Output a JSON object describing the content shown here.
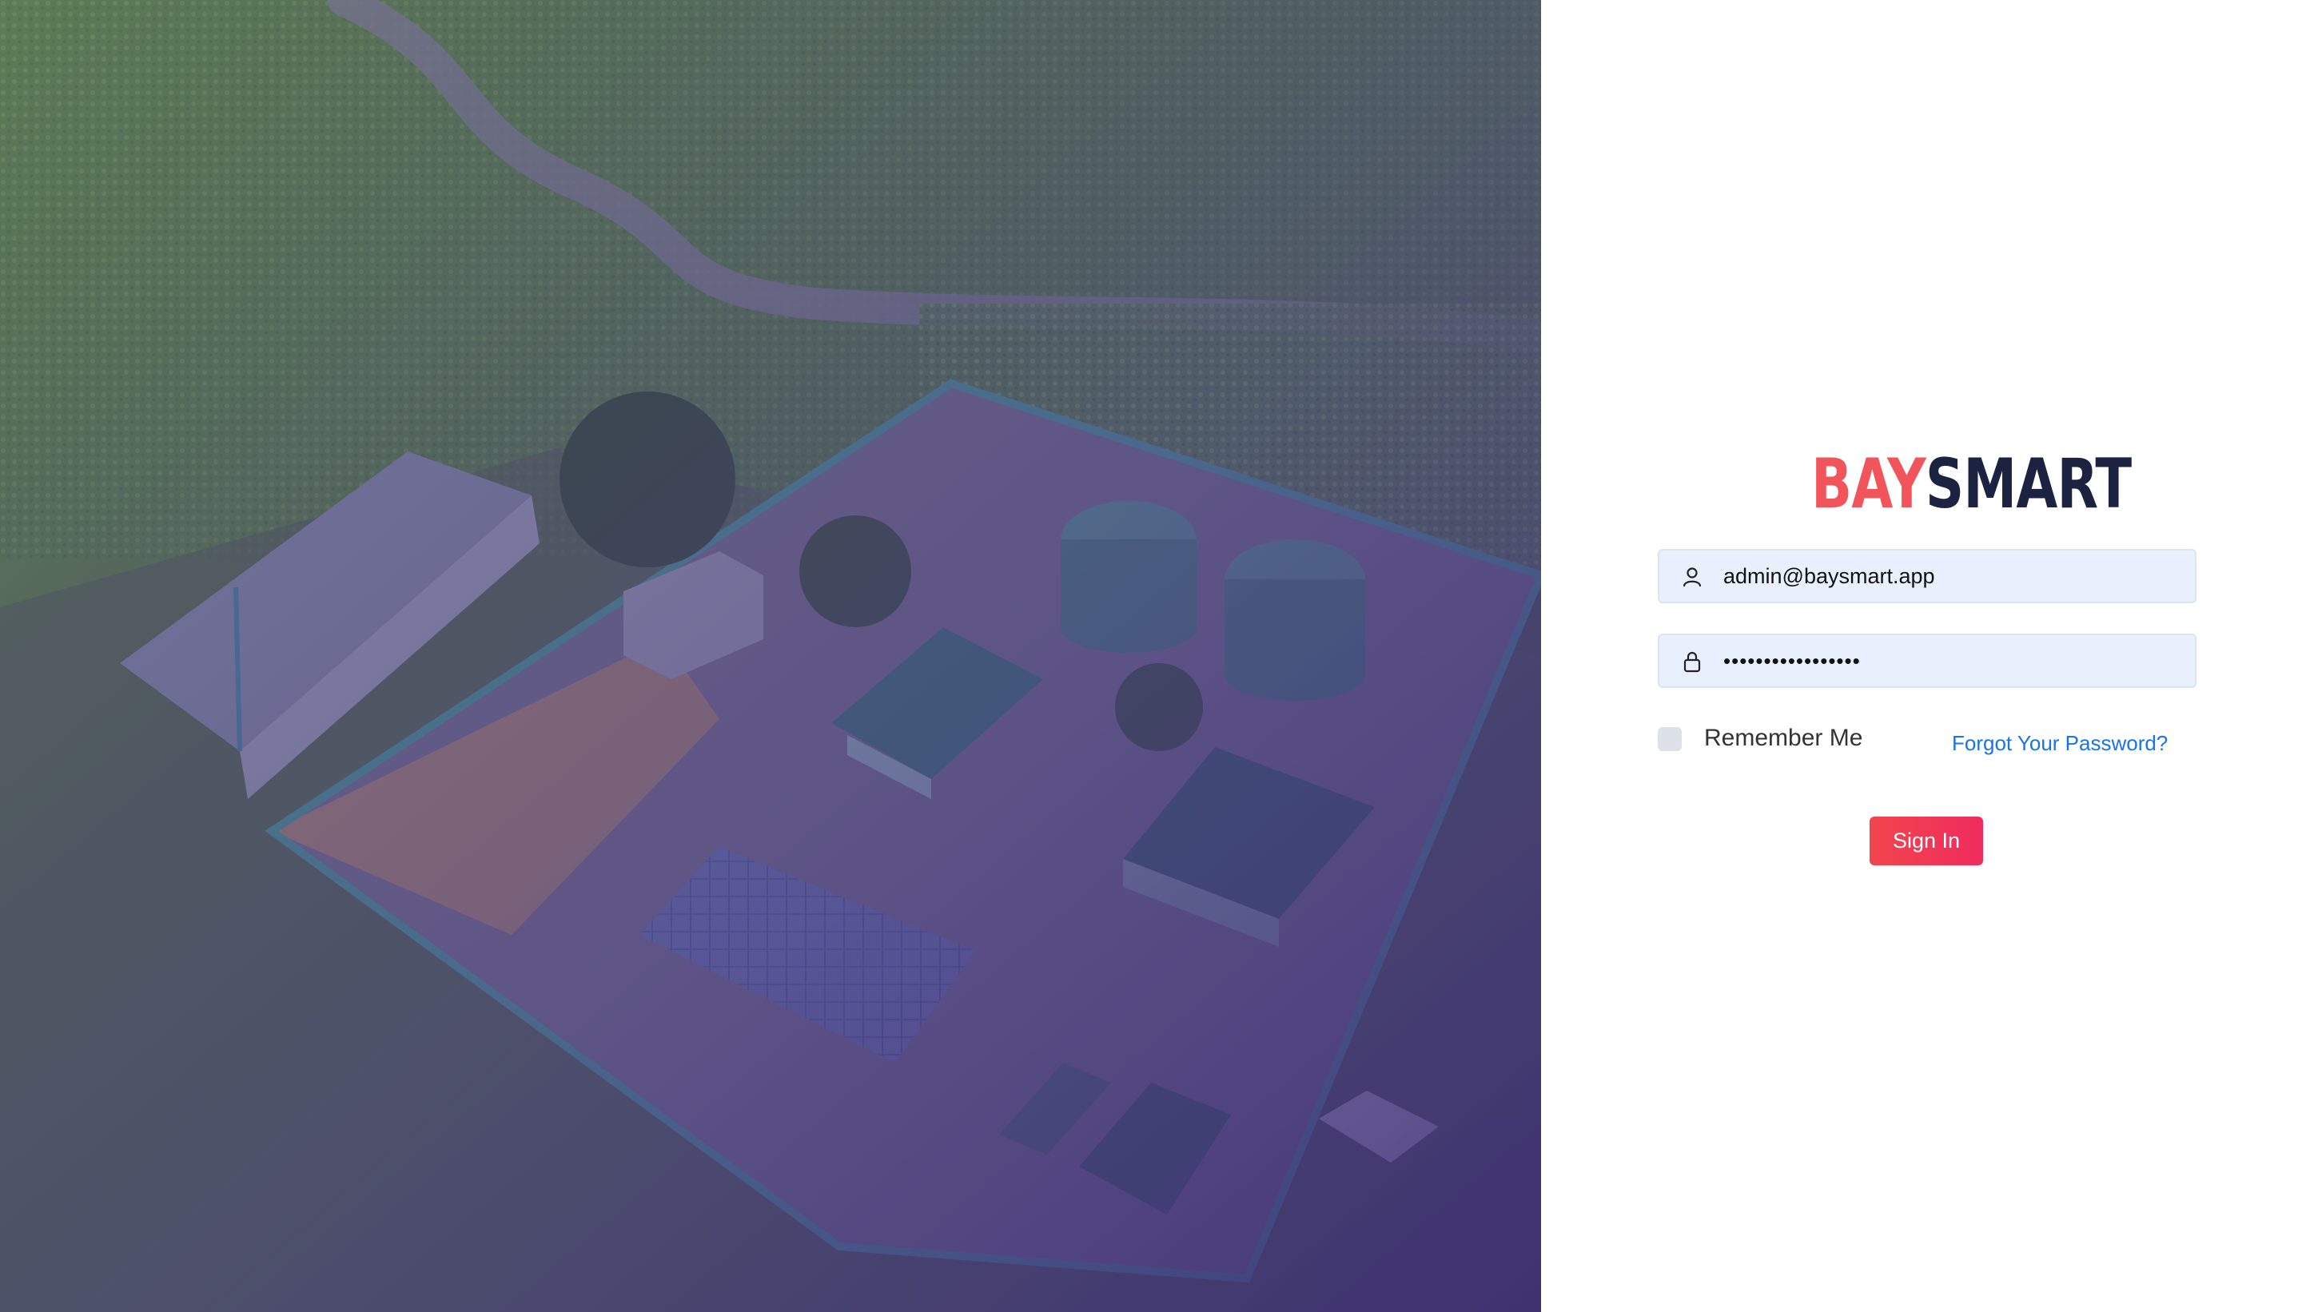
{
  "hero": {
    "image_description_icon": "aerial-facility-photo"
  },
  "brand": {
    "logo_part1": "BAY",
    "logo_part2": "SMART",
    "color_primary": "#f2545b",
    "color_secondary": "#1b2340"
  },
  "form": {
    "email": {
      "icon": "user-icon",
      "value": "admin@baysmart.app"
    },
    "password": {
      "icon": "lock-icon",
      "value": "•••••••••••••••••"
    },
    "remember_label": "Remember Me",
    "remember_checked": false,
    "forgot_label": "Forgot Your Password?",
    "signin_label": "Sign In",
    "accent_color": "#ef2c5e",
    "link_color": "#1a73e8"
  }
}
